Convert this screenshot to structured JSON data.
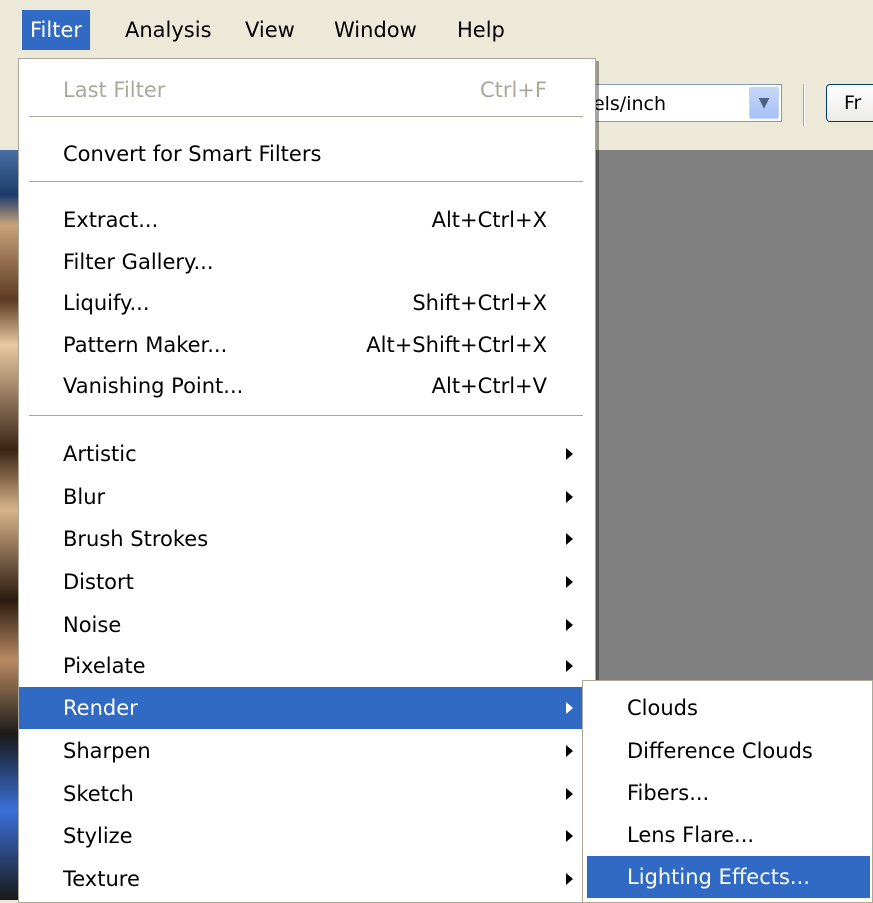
{
  "menubar": {
    "items": [
      {
        "label": "Filter",
        "active": true
      },
      {
        "label": "Analysis",
        "active": false
      },
      {
        "label": "View",
        "active": false
      },
      {
        "label": "Window",
        "active": false
      },
      {
        "label": "Help",
        "active": false
      }
    ]
  },
  "toolbar": {
    "resolution_unit_value": "ixels/inch",
    "front_button_label": "Fr"
  },
  "filter_menu": {
    "last_filter": {
      "label": "Last Filter",
      "shortcut": "Ctrl+F"
    },
    "convert_smart": {
      "label": "Convert for Smart Filters"
    },
    "extract": {
      "label": "Extract...",
      "shortcut": "Alt+Ctrl+X"
    },
    "filter_gallery": {
      "label": "Filter Gallery..."
    },
    "liquify": {
      "label": "Liquify...",
      "shortcut": "Shift+Ctrl+X"
    },
    "pattern_maker": {
      "label": "Pattern Maker...",
      "shortcut": "Alt+Shift+Ctrl+X"
    },
    "vanishing_point": {
      "label": "Vanishing Point...",
      "shortcut": "Alt+Ctrl+V"
    },
    "categories": [
      {
        "label": "Artistic"
      },
      {
        "label": "Blur"
      },
      {
        "label": "Brush Strokes"
      },
      {
        "label": "Distort"
      },
      {
        "label": "Noise"
      },
      {
        "label": "Pixelate"
      },
      {
        "label": "Render"
      },
      {
        "label": "Sharpen"
      },
      {
        "label": "Sketch"
      },
      {
        "label": "Stylize"
      },
      {
        "label": "Texture"
      }
    ]
  },
  "render_submenu": {
    "items": [
      {
        "label": "Clouds"
      },
      {
        "label": "Difference Clouds"
      },
      {
        "label": "Fibers..."
      },
      {
        "label": "Lens Flare..."
      },
      {
        "label": "Lighting Effects..."
      }
    ]
  },
  "colors": {
    "highlight": "#316ac5",
    "menu_background": "#ffffff",
    "chrome": "#ece9d8",
    "canvas": "#808080",
    "disabled_text": "#aca899"
  }
}
